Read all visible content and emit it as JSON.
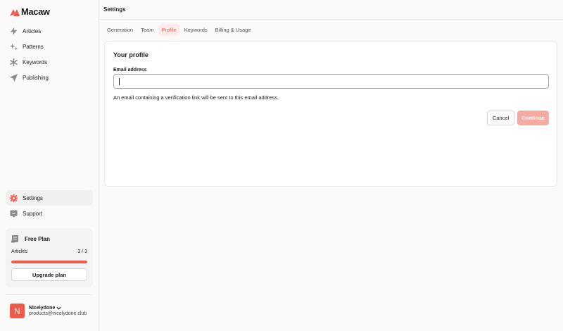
{
  "app": {
    "name": "Macaw"
  },
  "sidebar": {
    "items": [
      {
        "label": "Articles",
        "icon": "lightning-icon"
      },
      {
        "label": "Patterns",
        "icon": "sparkles-icon"
      },
      {
        "label": "Keywords",
        "icon": "asterisk-icon"
      },
      {
        "label": "Publishing",
        "icon": "send-icon"
      }
    ],
    "bottom_items": [
      {
        "label": "Settings",
        "icon": "gear-icon",
        "active": true
      },
      {
        "label": "Support",
        "icon": "support-icon"
      }
    ]
  },
  "plan": {
    "title": "Free Plan",
    "metric_label": "Articles",
    "metric_value": "3 / 3",
    "usage_fraction": 1.0,
    "upgrade_label": "Upgrade plan"
  },
  "user": {
    "initial": "N",
    "name": "Nicelydone",
    "email": "products@nicelydone.club"
  },
  "header": {
    "title": "Settings"
  },
  "tabs": [
    {
      "label": "Generation"
    },
    {
      "label": "Team"
    },
    {
      "label": "Profile",
      "active": true
    },
    {
      "label": "Keywords"
    },
    {
      "label": "Billing & Usage"
    }
  ],
  "profile": {
    "title": "Your profile",
    "email_label": "Email address",
    "email_value": "",
    "hint": "An email containing a verification link will be sent to this email address.",
    "cancel_label": "Cancel",
    "continue_label": "Continue"
  },
  "colors": {
    "accent": "#ef5a4b",
    "accent_light": "#f6aaa2",
    "tab_active_bg": "#fdeceb"
  }
}
